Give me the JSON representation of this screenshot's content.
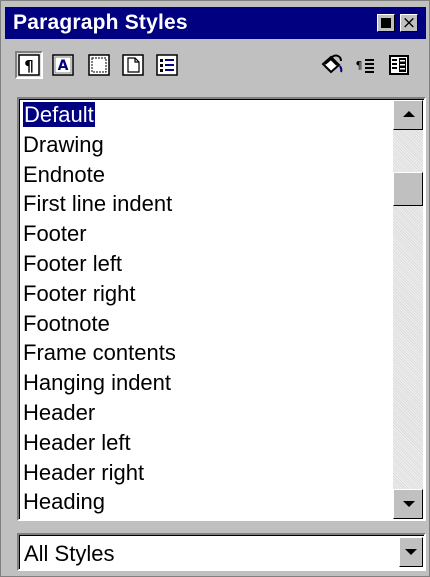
{
  "window": {
    "title": "Paragraph Styles"
  },
  "toolbar": {
    "buttons": [
      {
        "icon": "paragraph-styles-icon",
        "pressed": true
      },
      {
        "icon": "character-styles-icon",
        "pressed": false
      },
      {
        "icon": "frame-styles-icon",
        "pressed": false
      },
      {
        "icon": "page-styles-icon",
        "pressed": false
      },
      {
        "icon": "numbering-styles-icon",
        "pressed": false
      },
      {
        "icon": "fill-format-mode-icon",
        "pressed": false
      },
      {
        "icon": "new-style-from-selection-icon",
        "pressed": false
      },
      {
        "icon": "update-style-icon",
        "pressed": false
      }
    ]
  },
  "styles_list": {
    "items": [
      "Default",
      "Drawing",
      "Endnote",
      "First line indent",
      "Footer",
      "Footer left",
      "Footer right",
      "Footnote",
      "Frame contents",
      "Hanging indent",
      "Header",
      "Header left",
      "Header right",
      "Heading"
    ],
    "selected": "Default"
  },
  "filter": {
    "value": "All Styles"
  },
  "colors": {
    "titlebar": "#000080",
    "selection": "#000080",
    "face": "#c0c0c0"
  }
}
